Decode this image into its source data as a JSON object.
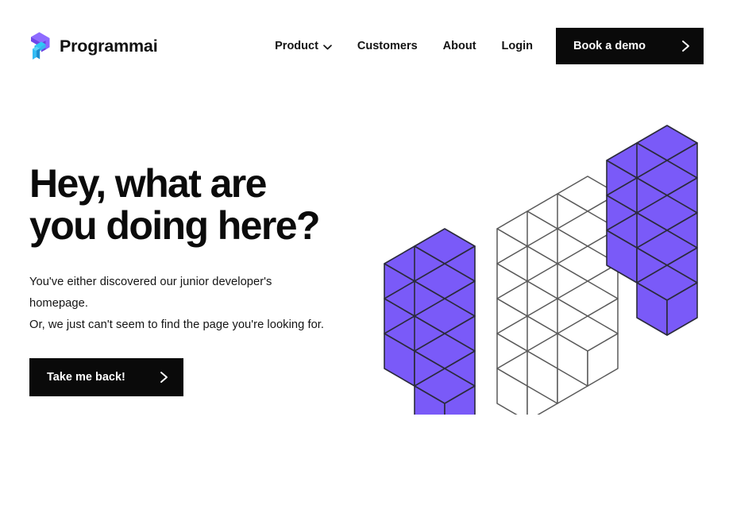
{
  "brand": {
    "name": "Programmai",
    "logo_icon": "programmai-isometric-p-logo",
    "logo_purple": "#7A5AF8",
    "logo_cyan": "#29C2F2",
    "logo_blue": "#3A6FF5"
  },
  "nav": {
    "items": [
      {
        "label": "Product",
        "has_dropdown": true,
        "icon": "chevron-down-icon"
      },
      {
        "label": "Customers",
        "has_dropdown": false
      },
      {
        "label": "About",
        "has_dropdown": false
      },
      {
        "label": "Login",
        "has_dropdown": false
      }
    ],
    "cta": {
      "label": "Book a demo",
      "icon": "chevron-right-icon",
      "background": "#0A0A0A",
      "text_color": "#FFFFFF"
    }
  },
  "hero": {
    "headline": "Hey, what are\nyou doing here?",
    "subtext": "You've either discovered our junior developer's\nhomepage.\nOr, we just can't seem to find the page you're looking for.",
    "cta": {
      "label": "Take me back!",
      "icon": "chevron-right-icon",
      "background": "#0A0A0A",
      "text_color": "#FFFFFF"
    }
  },
  "illustration": {
    "name": "isometric-cube-stacks",
    "description": "Three isometric block stacks: left purple group, center white outlined group, right purple group",
    "cube_fill": "#7A5AF8",
    "cube_stroke": "#2B2B3B",
    "outline_fill": "#FFFFFF",
    "outline_stroke": "#5A5A5A",
    "groups": [
      {
        "name": "left-purple-stack",
        "color": "#7A5AF8",
        "columns": [
          3,
          5
        ]
      },
      {
        "name": "center-white-stack",
        "color": "#FFFFFF",
        "columns": [
          5,
          5,
          5
        ]
      },
      {
        "name": "right-purple-stack",
        "color": "#7A5AF8",
        "columns": [
          3,
          5
        ]
      }
    ]
  },
  "page": {
    "background": "#FFFFFF",
    "text_color": "#111111"
  }
}
